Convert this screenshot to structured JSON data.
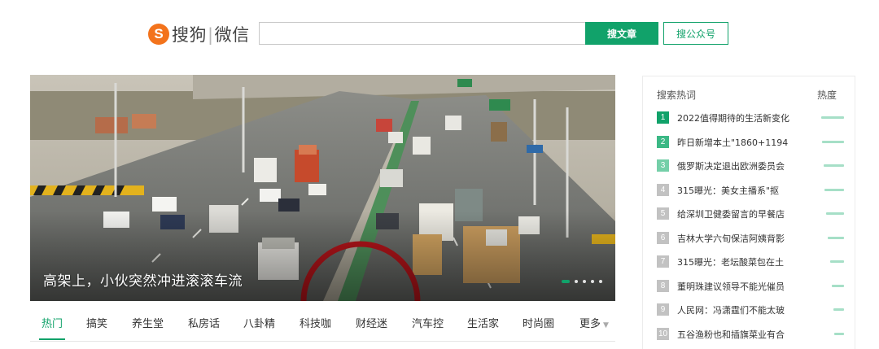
{
  "header": {
    "logo_mark": "S",
    "logo_name_left": "搜狗",
    "logo_name_right": "微信",
    "search_placeholder": "",
    "btn_article": "搜文章",
    "btn_account": "搜公众号"
  },
  "banner": {
    "caption": "高架上，小伙突然冲进滚滚车流",
    "slide_count": 5,
    "active_slide": 1
  },
  "tabs": [
    {
      "label": "热门"
    },
    {
      "label": "搞笑"
    },
    {
      "label": "养生堂"
    },
    {
      "label": "私房话"
    },
    {
      "label": "八卦精"
    },
    {
      "label": "科技咖"
    },
    {
      "label": "财经迷"
    },
    {
      "label": "汽车控"
    },
    {
      "label": "生活家"
    },
    {
      "label": "时尚圈"
    },
    {
      "label": "更多"
    }
  ],
  "hot": {
    "title": "搜索热词",
    "heat_label": "热度",
    "items": [
      {
        "rank": "1",
        "text": "2022值得期待的生活新变化",
        "heat": 1.0
      },
      {
        "rank": "2",
        "text": "昨日新增本土\"1860+1194",
        "heat": 0.95
      },
      {
        "rank": "3",
        "text": "俄罗斯决定退出欧洲委员会",
        "heat": 0.9
      },
      {
        "rank": "4",
        "text": "315曝光：美女主播系\"抠",
        "heat": 0.85
      },
      {
        "rank": "5",
        "text": "给深圳卫健委留言的早餐店",
        "heat": 0.78
      },
      {
        "rank": "6",
        "text": "吉林大学六旬保洁阿姨背影",
        "heat": 0.7
      },
      {
        "rank": "7",
        "text": "315曝光：老坛酸菜包在土",
        "heat": 0.62
      },
      {
        "rank": "8",
        "text": "董明珠建议领导不能光催员",
        "heat": 0.55
      },
      {
        "rank": "9",
        "text": "人民网：冯潇霆们不能太玻",
        "heat": 0.48
      },
      {
        "rank": "10",
        "text": "五谷渔粉也和插旗菜业有合",
        "heat": 0.42
      }
    ]
  },
  "colors": {
    "accent": "#11a26a",
    "logo": "#f3731c",
    "rank_top": [
      "#11a26a",
      "#3bb885",
      "#74cfa8"
    ],
    "rank_rest": "#c2c2c2"
  }
}
